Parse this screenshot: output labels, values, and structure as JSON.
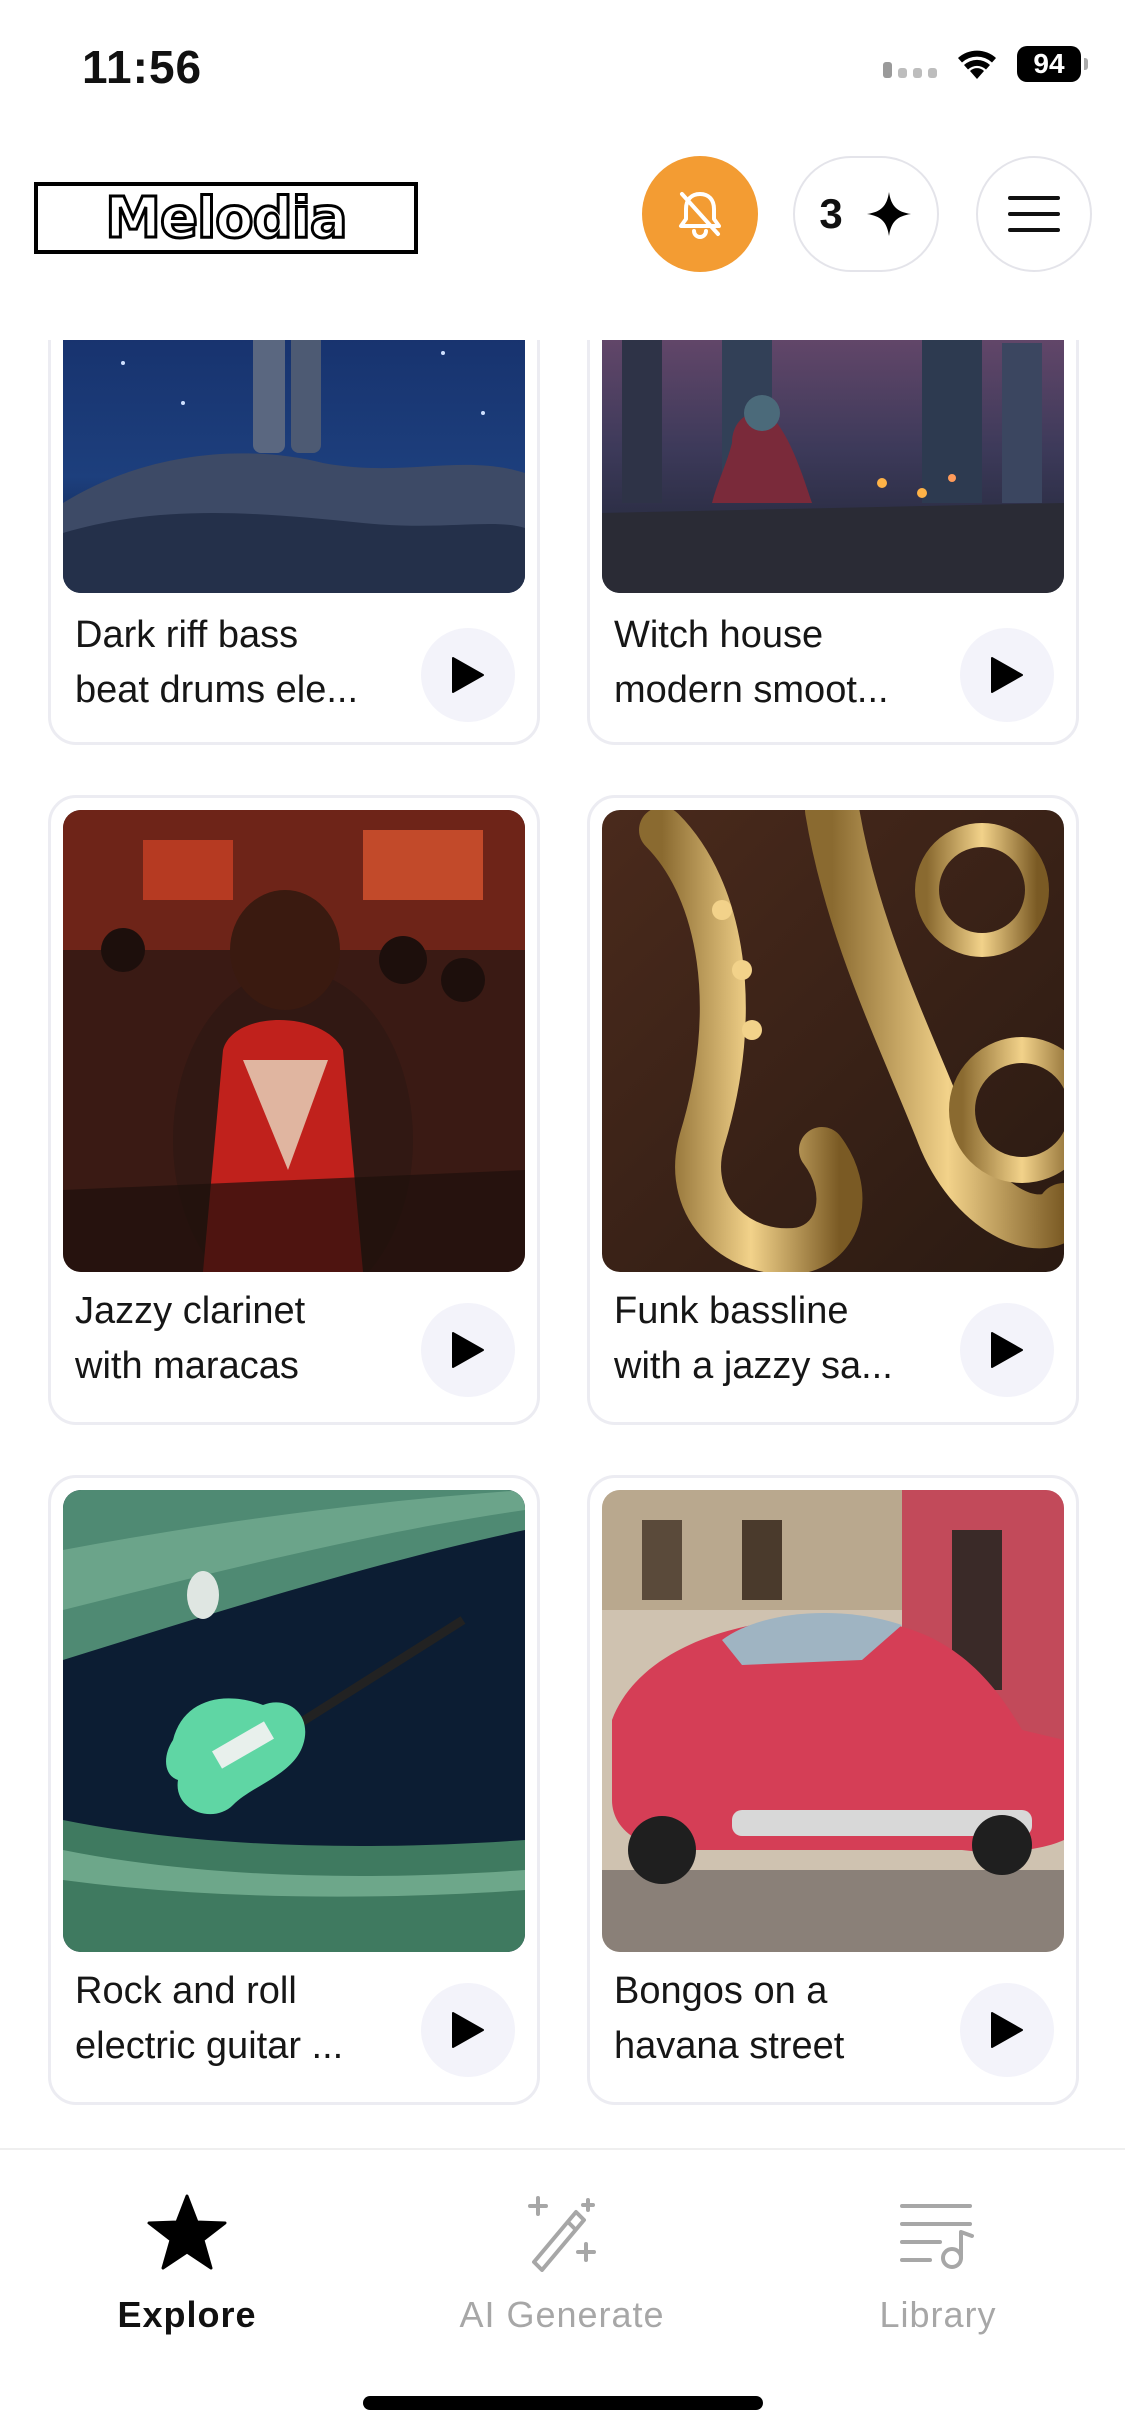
{
  "status_bar": {
    "time": "11:56",
    "battery": "94"
  },
  "header": {
    "logo": "Melodia",
    "credits": "3"
  },
  "cards": [
    {
      "title_line1": "Dark riff bass",
      "title_line2": "beat drums ele..."
    },
    {
      "title_line1": "Witch house",
      "title_line2": "modern smoot..."
    },
    {
      "title_line1": "Jazzy clarinet",
      "title_line2": "with maracas"
    },
    {
      "title_line1": "Funk bassline",
      "title_line2": "with a jazzy sa..."
    },
    {
      "title_line1": "Rock and roll",
      "title_line2": "electric guitar ..."
    },
    {
      "title_line1": "Bongos on a",
      "title_line2": "havana street"
    }
  ],
  "bottom_nav": [
    {
      "label": "Explore",
      "icon": "star-icon",
      "active": true
    },
    {
      "label": "AI Generate",
      "icon": "magic-wand-icon",
      "active": false
    },
    {
      "label": "Library",
      "icon": "music-list-icon",
      "active": false
    }
  ],
  "colors": {
    "accent": "#f39c33",
    "play_bg": "#f3f3fa",
    "card_border": "#ececf2",
    "inactive": "#a7a7a7"
  }
}
